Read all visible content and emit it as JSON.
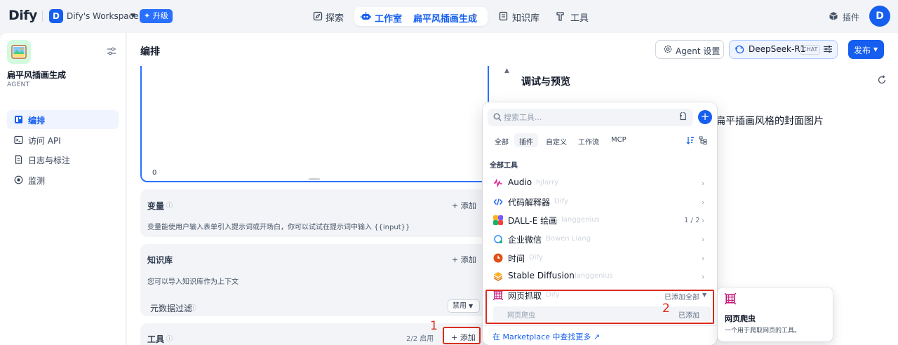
{
  "topbar": {
    "logo": "Dify",
    "workspace_initial": "D",
    "workspace_name": "Dify's Workspace",
    "upgrade_label": "✦ 升级",
    "nav_explore": "探索",
    "nav_studio": "工作室",
    "current_app": "扁平风插画生成",
    "nav_knowledge": "知识库",
    "nav_tools": "工具",
    "plugins_label": "插件",
    "avatar_initial": "D"
  },
  "sidebar": {
    "app_name": "扁平风插画生成",
    "app_type": "AGENT",
    "items": [
      {
        "label": "编排",
        "icon": "layout-icon",
        "active": true
      },
      {
        "label": "访问 API",
        "icon": "terminal-icon",
        "active": false
      },
      {
        "label": "日志与标注",
        "icon": "file-list-icon",
        "active": false
      },
      {
        "label": "监测",
        "icon": "monitor-icon",
        "active": false
      }
    ]
  },
  "main": {
    "title": "编排",
    "agent_settings_label": "Agent 设置",
    "model_name": "DeepSeek-R1",
    "model_mode": "CHAT",
    "publish_label": "发布",
    "prompt_char_count": "0"
  },
  "variables": {
    "title": "变量",
    "add_label": "+ 添加",
    "description": "变量能使用户输入表单引入提示词或开场白，你可以试试在提示词中输入 {{input}}"
  },
  "knowledge": {
    "title": "知识库",
    "add_label": "+ 添加",
    "description": "您可以导入知识库作为上下文"
  },
  "metadata_filter": {
    "title": "元数据过滤",
    "select_value": "禁用"
  },
  "tools_card": {
    "title": "工具",
    "count": "2/2 启用",
    "add_label": "+ 添加"
  },
  "annotations": {
    "one": "1",
    "two": "2"
  },
  "debug": {
    "title": "调试与预览",
    "message_fragment": "扁平插画风格的封面图片"
  },
  "tool_picker": {
    "search_placeholder": "搜索工具...",
    "tabs": [
      "全部",
      "插件",
      "自定义",
      "工作流",
      "MCP"
    ],
    "active_tab": "插件",
    "section_title": "全部工具",
    "tools": [
      {
        "name": "Audio",
        "author": "hjlarry",
        "icon": "audio-icon"
      },
      {
        "name": "代码解释器",
        "author": "Dify",
        "icon": "code-icon"
      },
      {
        "name": "DALL-E 绘画",
        "author": "langgenius",
        "icon": "dalle-icon",
        "count": "1 / 2"
      },
      {
        "name": "企业微信",
        "author": "Bowen Liang",
        "icon": "wecom-icon"
      },
      {
        "name": "时间",
        "author": "Dify",
        "icon": "clock-icon"
      },
      {
        "name": "Stable Diffusion",
        "author": "langgenius",
        "icon": "stable-diffusion-icon"
      }
    ],
    "expanded_tool": {
      "name": "网页抓取",
      "author": "Dify",
      "status": "已添加全部",
      "sub_tool": "网页爬虫",
      "sub_status": "已添加"
    },
    "marketplace_link": "在 Marketplace 中查找更多 ↗"
  },
  "tooltip": {
    "title": "网页爬虫",
    "description": "一个用于爬取网页的工具。"
  }
}
